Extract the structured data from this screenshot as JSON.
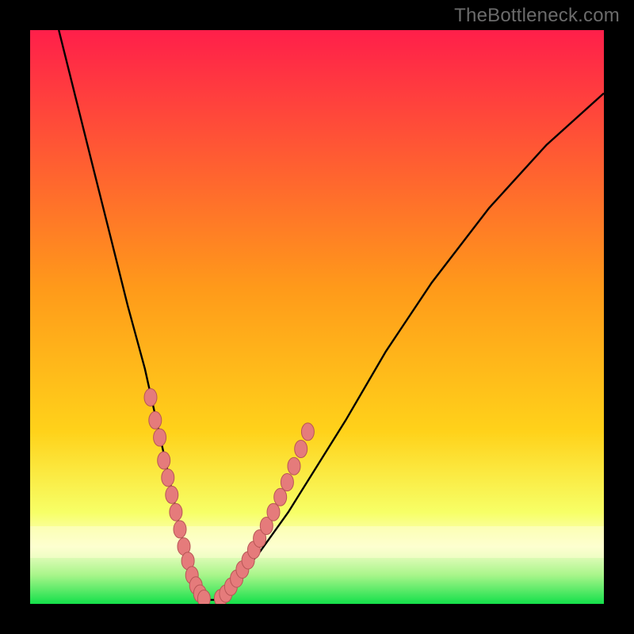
{
  "watermark": "TheBottleneck.com",
  "colors": {
    "frame_bg": "#000000",
    "watermark": "#6b6b6b",
    "gradient_top": "#ff1f4a",
    "gradient_mid": "#ffd21a",
    "gradient_low": "#f7ff66",
    "gradient_band": "#fdffd0",
    "gradient_bottom": "#14e04a",
    "curve": "#000000",
    "dot_fill": "#e57b7b",
    "dot_stroke": "#b85656"
  },
  "chart_data": {
    "type": "line",
    "title": "",
    "xlabel": "",
    "ylabel": "",
    "xlim": [
      0,
      100
    ],
    "ylim": [
      0,
      100
    ],
    "series": [
      {
        "name": "curve",
        "x": [
          5,
          8,
          11,
          14,
          17,
          20,
          22,
          24,
          25.5,
          27,
          28,
          29,
          30,
          32.5,
          36,
          40,
          45,
          50,
          55,
          62,
          70,
          80,
          90,
          100
        ],
        "y": [
          100,
          88,
          76,
          64,
          52,
          41,
          32,
          23,
          16,
          9,
          5,
          2,
          0.7,
          0.7,
          4,
          9,
          16,
          24,
          32,
          44,
          56,
          69,
          80,
          89
        ]
      }
    ],
    "dots_left": {
      "name": "dots-left-branch",
      "x": [
        21.0,
        21.8,
        22.6,
        23.3,
        24.0,
        24.7,
        25.4,
        26.1,
        26.8,
        27.5,
        28.2,
        28.9,
        29.6,
        30.3
      ],
      "y": [
        36,
        32,
        29,
        25,
        22,
        19,
        16,
        13,
        10,
        7.5,
        5,
        3.2,
        1.8,
        0.9
      ]
    },
    "dots_right": {
      "name": "dots-right-branch",
      "x": [
        33.2,
        34.1,
        35.0,
        36.0,
        37.0,
        38.0,
        39.0,
        40.0,
        41.2,
        42.4,
        43.6,
        44.8,
        46.0,
        47.2,
        48.4
      ],
      "y": [
        1.0,
        1.8,
        3.0,
        4.4,
        6.0,
        7.6,
        9.4,
        11.4,
        13.6,
        16.0,
        18.6,
        21.2,
        24.0,
        27.0,
        30.0
      ]
    }
  }
}
